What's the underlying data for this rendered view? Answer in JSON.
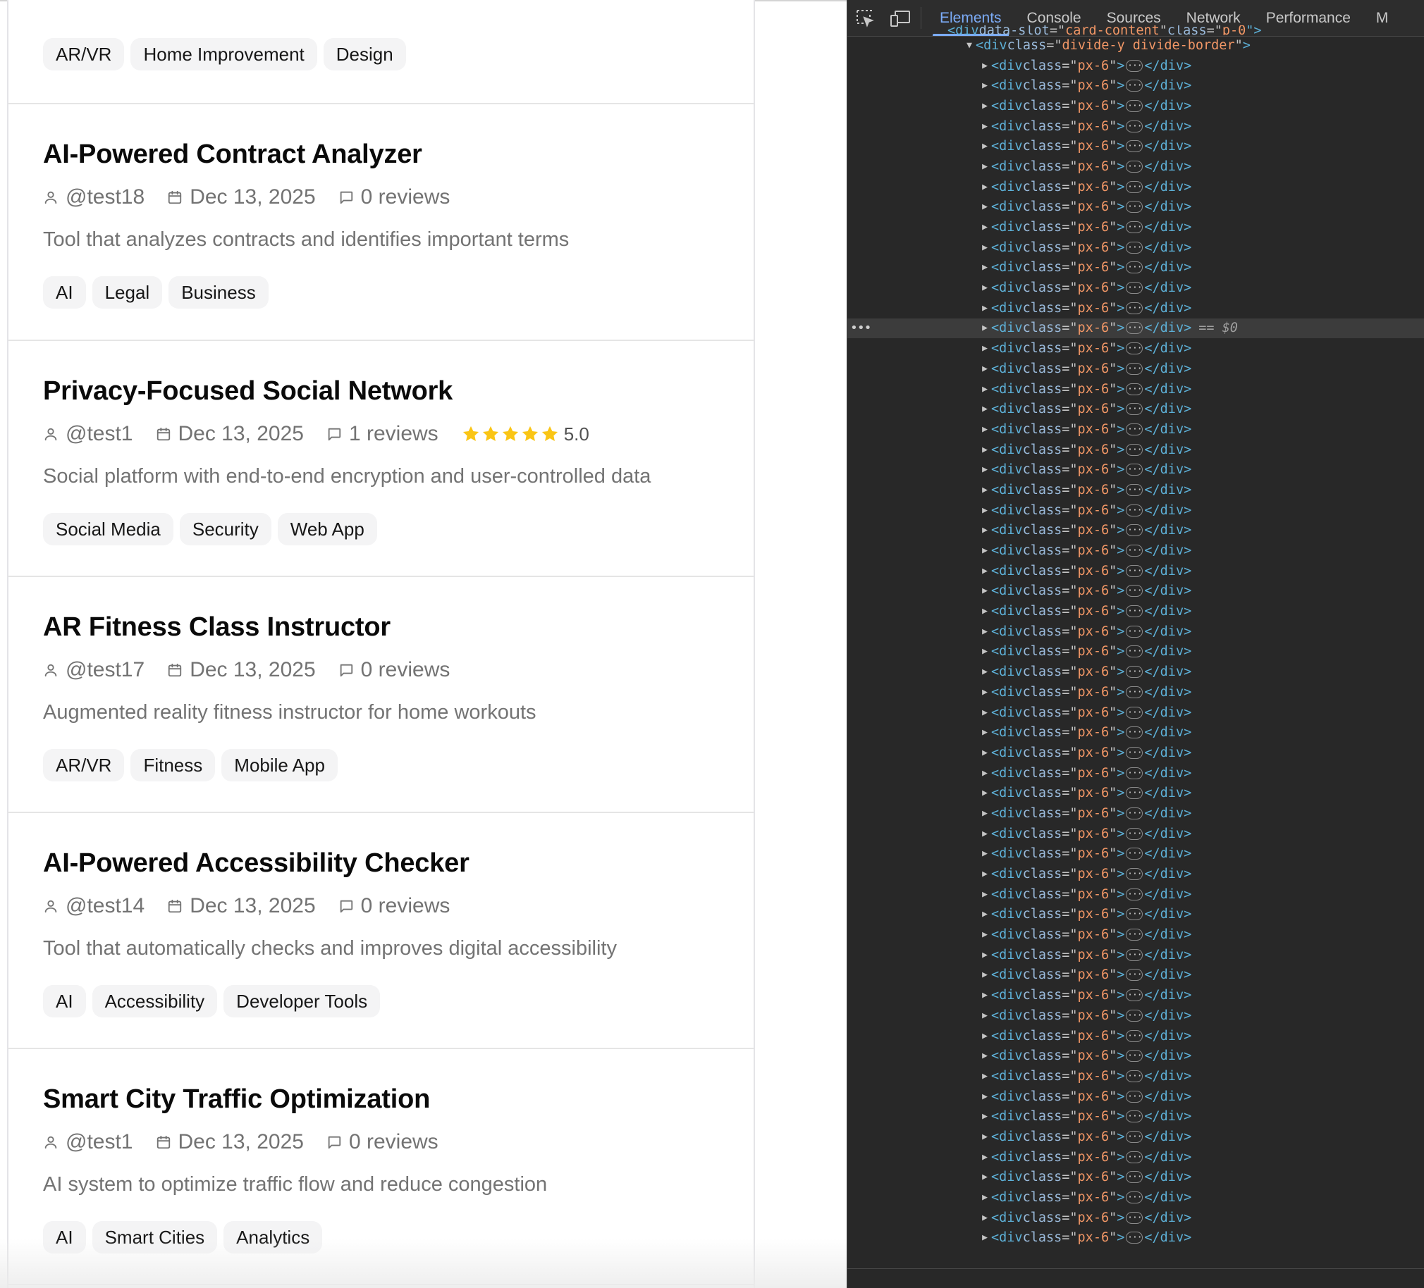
{
  "ideas": [
    {
      "title": "",
      "author": "",
      "date": "",
      "reviews": "",
      "description": "",
      "tags": [
        "AR/VR",
        "Home Improvement",
        "Design"
      ],
      "partial": true
    },
    {
      "title": "AI-Powered Contract Analyzer",
      "author": "@test18",
      "date": "Dec 13, 2025",
      "reviews": "0 reviews",
      "description": "Tool that analyzes contracts and identifies important terms",
      "tags": [
        "AI",
        "Legal",
        "Business"
      ]
    },
    {
      "title": "Privacy-Focused Social Network",
      "author": "@test1",
      "date": "Dec 13, 2025",
      "reviews": "1 reviews",
      "rating": "5.0",
      "stars": 5,
      "description": "Social platform with end-to-end encryption and user-controlled data",
      "tags": [
        "Social Media",
        "Security",
        "Web App"
      ]
    },
    {
      "title": "AR Fitness Class Instructor",
      "author": "@test17",
      "date": "Dec 13, 2025",
      "reviews": "0 reviews",
      "description": "Augmented reality fitness instructor for home workouts",
      "tags": [
        "AR/VR",
        "Fitness",
        "Mobile App"
      ]
    },
    {
      "title": "AI-Powered Accessibility Checker",
      "author": "@test14",
      "date": "Dec 13, 2025",
      "reviews": "0 reviews",
      "description": "Tool that automatically checks and improves digital accessibility",
      "tags": [
        "AI",
        "Accessibility",
        "Developer Tools"
      ]
    },
    {
      "title": "Smart City Traffic Optimization",
      "author": "@test1",
      "date": "Dec 13, 2025",
      "reviews": "0 reviews",
      "description": "AI system to optimize traffic flow and reduce congestion",
      "tags": [
        "AI",
        "Smart Cities",
        "Analytics"
      ]
    }
  ],
  "colors": {
    "star": "#fac515",
    "accent_devtools": "#7cacf8"
  },
  "devtools": {
    "tabs": [
      "Elements",
      "Console",
      "Sources",
      "Network",
      "Performance",
      "M"
    ],
    "active_tab": "Elements",
    "tools": [
      "inspect-element-icon",
      "device-toolbar-icon"
    ],
    "partial_line": {
      "tag": "div",
      "attr1": "data-slot",
      "val1": "card-content",
      "attr2": "class",
      "val2": "p-0"
    },
    "parent_line": {
      "tag": "div",
      "attr": "class",
      "val": "divide-y divide-border"
    },
    "child_tag": "div",
    "child_attr": "class",
    "child_val": "px-6",
    "child_count": 59,
    "selected_index": 13,
    "selected_marker": "== $0"
  }
}
